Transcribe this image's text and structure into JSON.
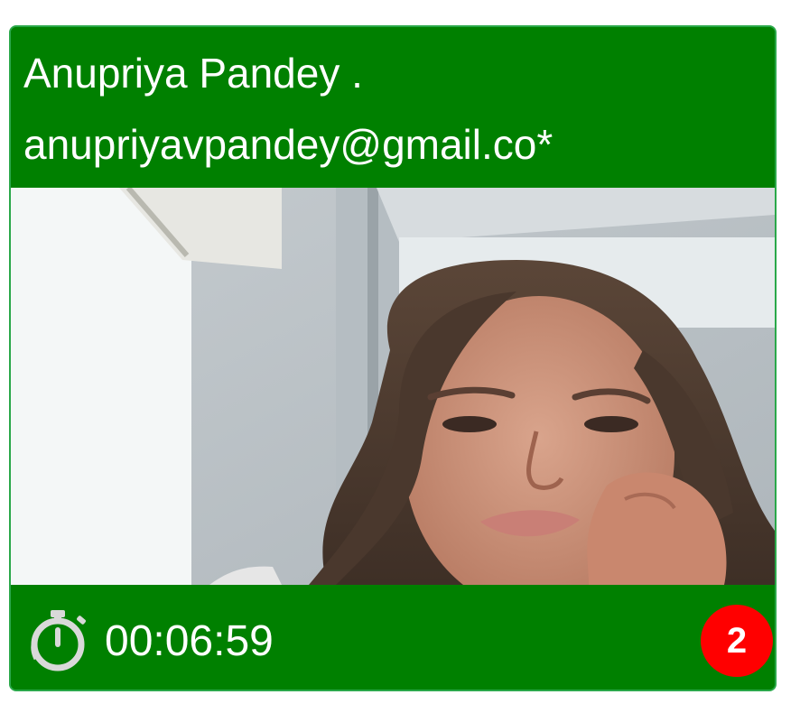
{
  "participant": {
    "name": "Anupriya Pandey .",
    "email": "anupriyavpandey@gmail.co*"
  },
  "video": {
    "description_icon": "webcam-video-feed"
  },
  "footer": {
    "timer_icon": "stopwatch-icon",
    "elapsed_time": "00:06:59",
    "alert_count": "2"
  },
  "colors": {
    "header_bg": "#008000",
    "footer_bg": "#008000",
    "border": "#2aa84a",
    "badge_bg": "#ff0000",
    "text": "#ffffff"
  }
}
